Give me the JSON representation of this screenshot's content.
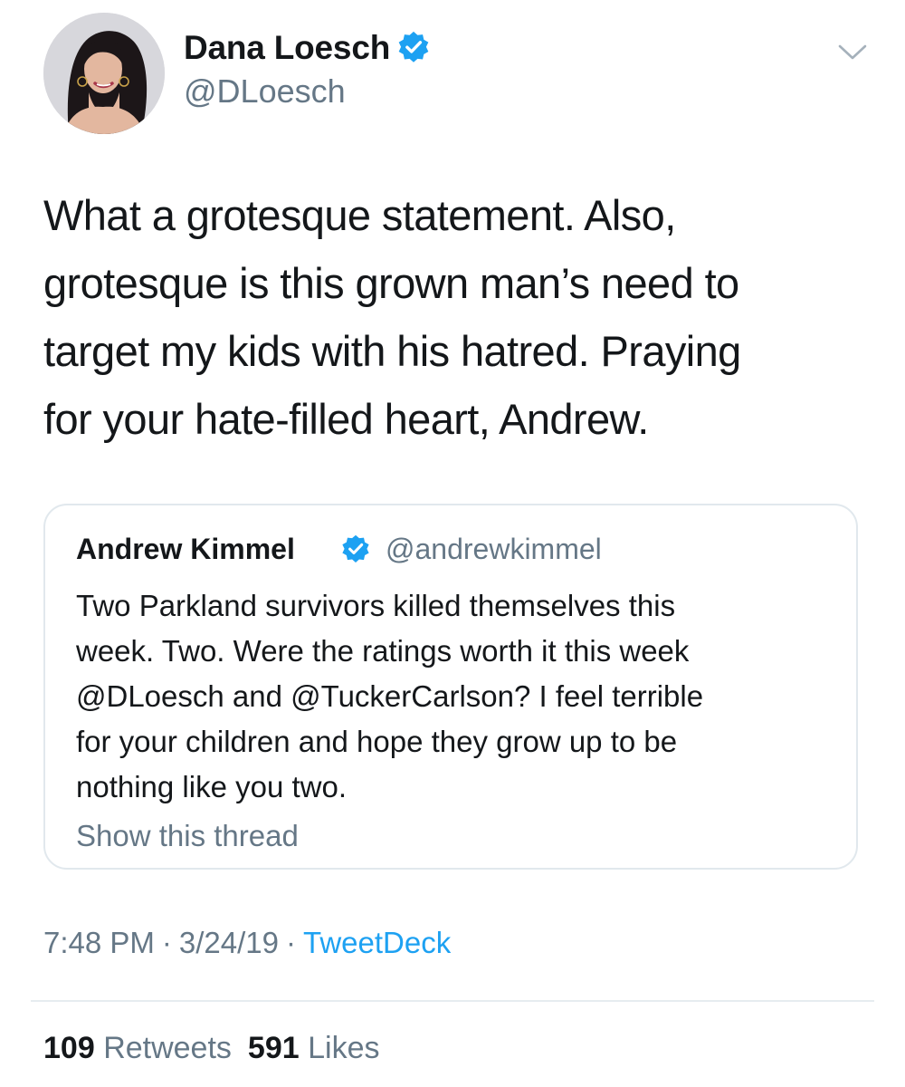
{
  "tweet": {
    "author": {
      "name": "Dana Loesch",
      "handle": "@DLoesch",
      "verified": true
    },
    "text": "What a grotesque statement. Also,\ngrotesque is this grown man’s need to\ntarget my kids with his hatred. Praying\nfor your hate-filled heart, Andrew.",
    "quoted_tweet": {
      "author_name": "Andrew Kimmel",
      "author_handle": "@andrewkimmel",
      "verified": true,
      "text": "Two Parkland survivors killed themselves this\nweek. Two. Were the ratings worth it this week\n@DLoesch and @TuckerCarlson? I feel terrible\nfor your children and hope they grow up to be\nnothing like you two.",
      "show_thread_label": "Show this thread"
    },
    "time": "7:48 PM",
    "date": "3/24/19",
    "separator": "·",
    "source": "TweetDeck",
    "stats": {
      "retweets_count": "109",
      "retweets_label": "Retweets",
      "likes_count": "591",
      "likes_label": "Likes"
    }
  },
  "icons": {
    "verified": "verified-badge-icon",
    "menu": "chevron-down-icon"
  },
  "colors": {
    "verified_blue": "#1da1f2",
    "text_primary": "#14171a",
    "text_secondary": "#657786",
    "border": "#e1e8ed",
    "link": "#1da1f2"
  }
}
